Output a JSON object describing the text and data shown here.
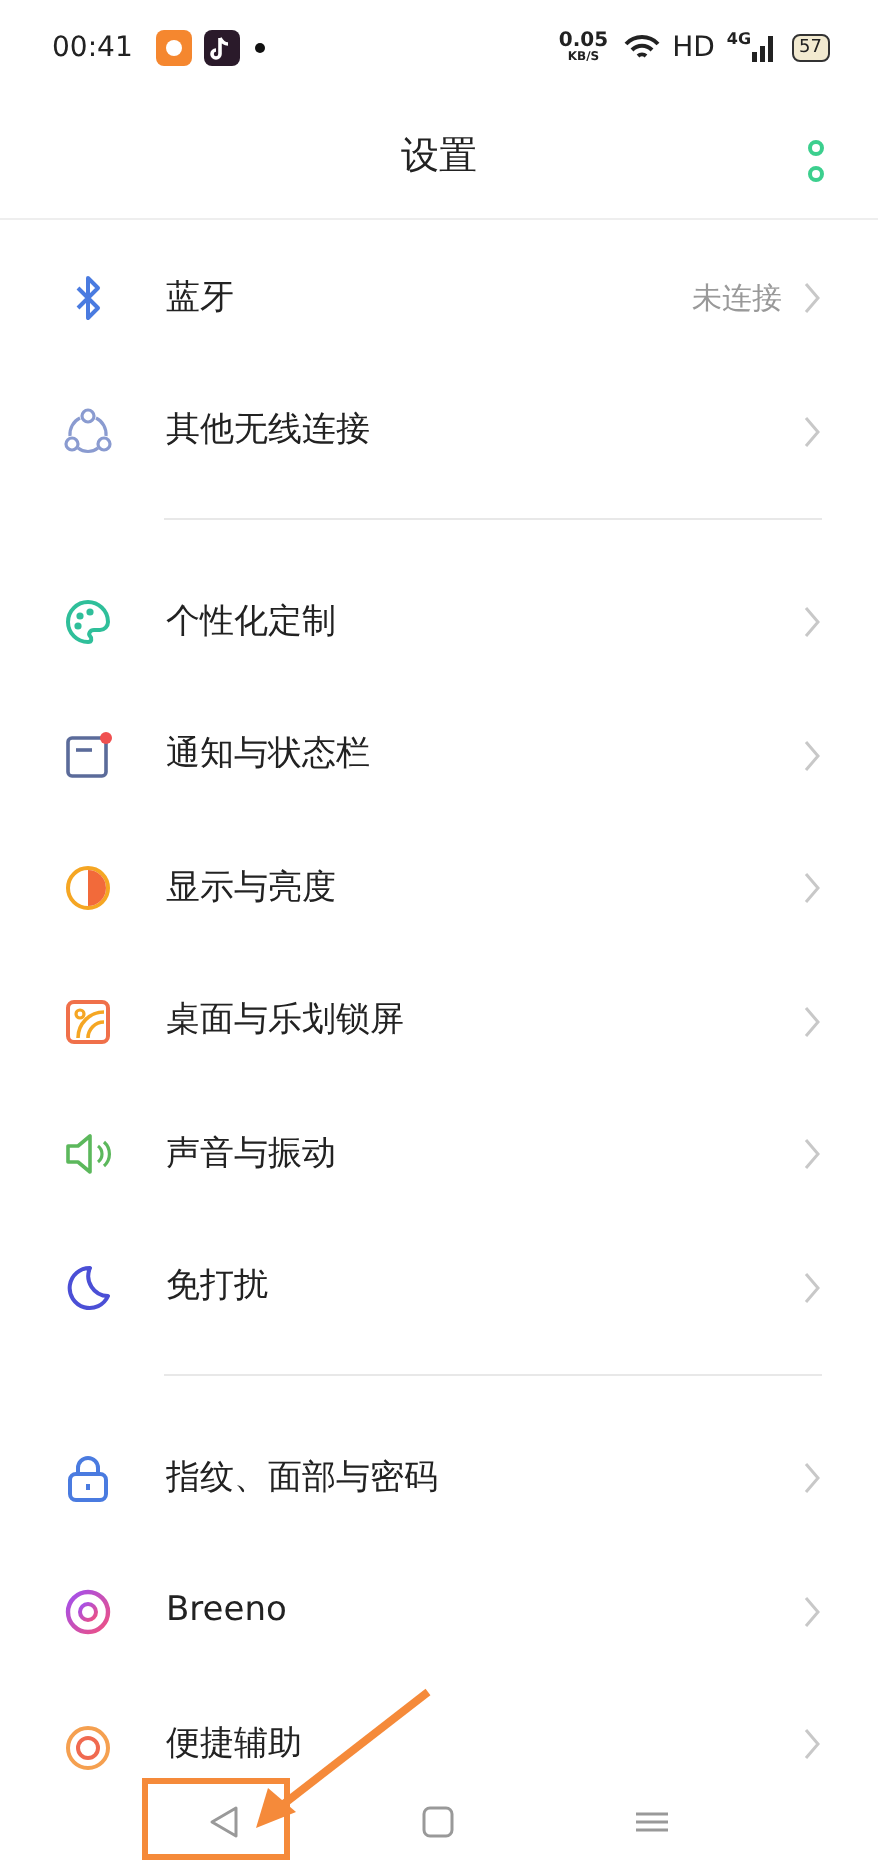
{
  "status_bar": {
    "time": "00:41",
    "speed": "0.05",
    "speed_unit": "KB/S",
    "hd": "HD",
    "network": "4G",
    "battery": "57"
  },
  "header": {
    "title": "设置"
  },
  "sections": [
    {
      "items": [
        {
          "label": "蓝牙",
          "value": "未连接"
        },
        {
          "label": "其他无线连接"
        }
      ]
    },
    {
      "items": [
        {
          "label": "个性化定制"
        },
        {
          "label": "通知与状态栏"
        },
        {
          "label": "显示与亮度"
        },
        {
          "label": "桌面与乐划锁屏"
        },
        {
          "label": "声音与振动"
        },
        {
          "label": "免打扰"
        }
      ]
    },
    {
      "items": [
        {
          "label": "指纹、面部与密码"
        },
        {
          "label": "Breeno"
        },
        {
          "label": "便捷辅助"
        }
      ]
    }
  ]
}
